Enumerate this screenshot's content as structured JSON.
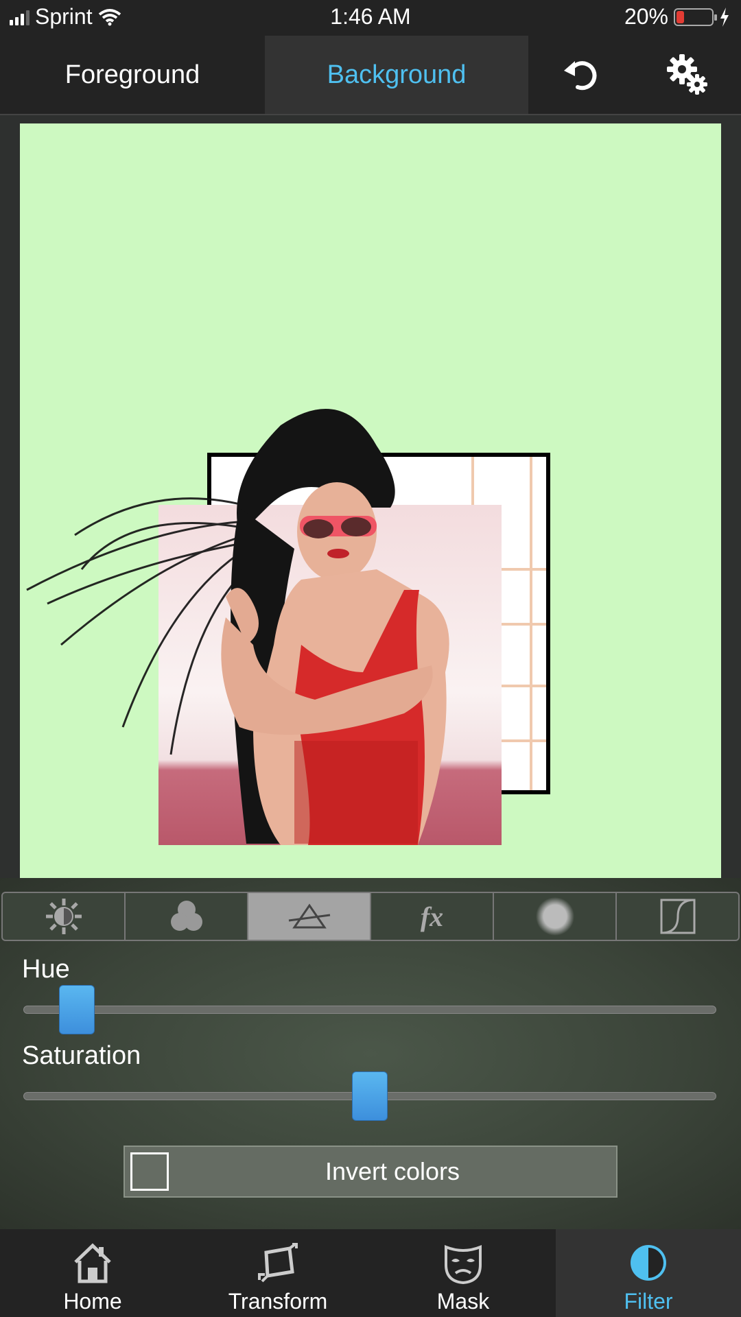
{
  "status": {
    "carrier": "Sprint",
    "time": "1:46 AM",
    "battery": "20%",
    "battery_level": 0.2,
    "battery_color": "#e23c34"
  },
  "topbar": {
    "foreground_tab": "Foreground",
    "background_tab": "Background",
    "undo_icon": "undo-icon",
    "settings_icon": "settings-gears-icon",
    "active_color": "#4fc0f0"
  },
  "canvas": {
    "background_color": "#cdf9c1"
  },
  "filter_tabs": [
    {
      "icon": "brightness-icon"
    },
    {
      "icon": "color-balance-icon"
    },
    {
      "icon": "prism-icon",
      "active": true
    },
    {
      "icon": "fx-icon",
      "text": "fx"
    },
    {
      "icon": "blur-icon"
    },
    {
      "icon": "curves-icon"
    }
  ],
  "sliders": {
    "hue": {
      "label": "Hue",
      "value": 0.06
    },
    "saturation": {
      "label": "Saturation",
      "value": 0.5
    }
  },
  "invert": {
    "label": "Invert colors",
    "checked": false
  },
  "bottomnav": [
    {
      "label": "Home",
      "icon": "home-icon"
    },
    {
      "label": "Transform",
      "icon": "transform-icon"
    },
    {
      "label": "Mask",
      "icon": "mask-icon"
    },
    {
      "label": "Filter",
      "icon": "filter-icon",
      "active": true
    }
  ]
}
